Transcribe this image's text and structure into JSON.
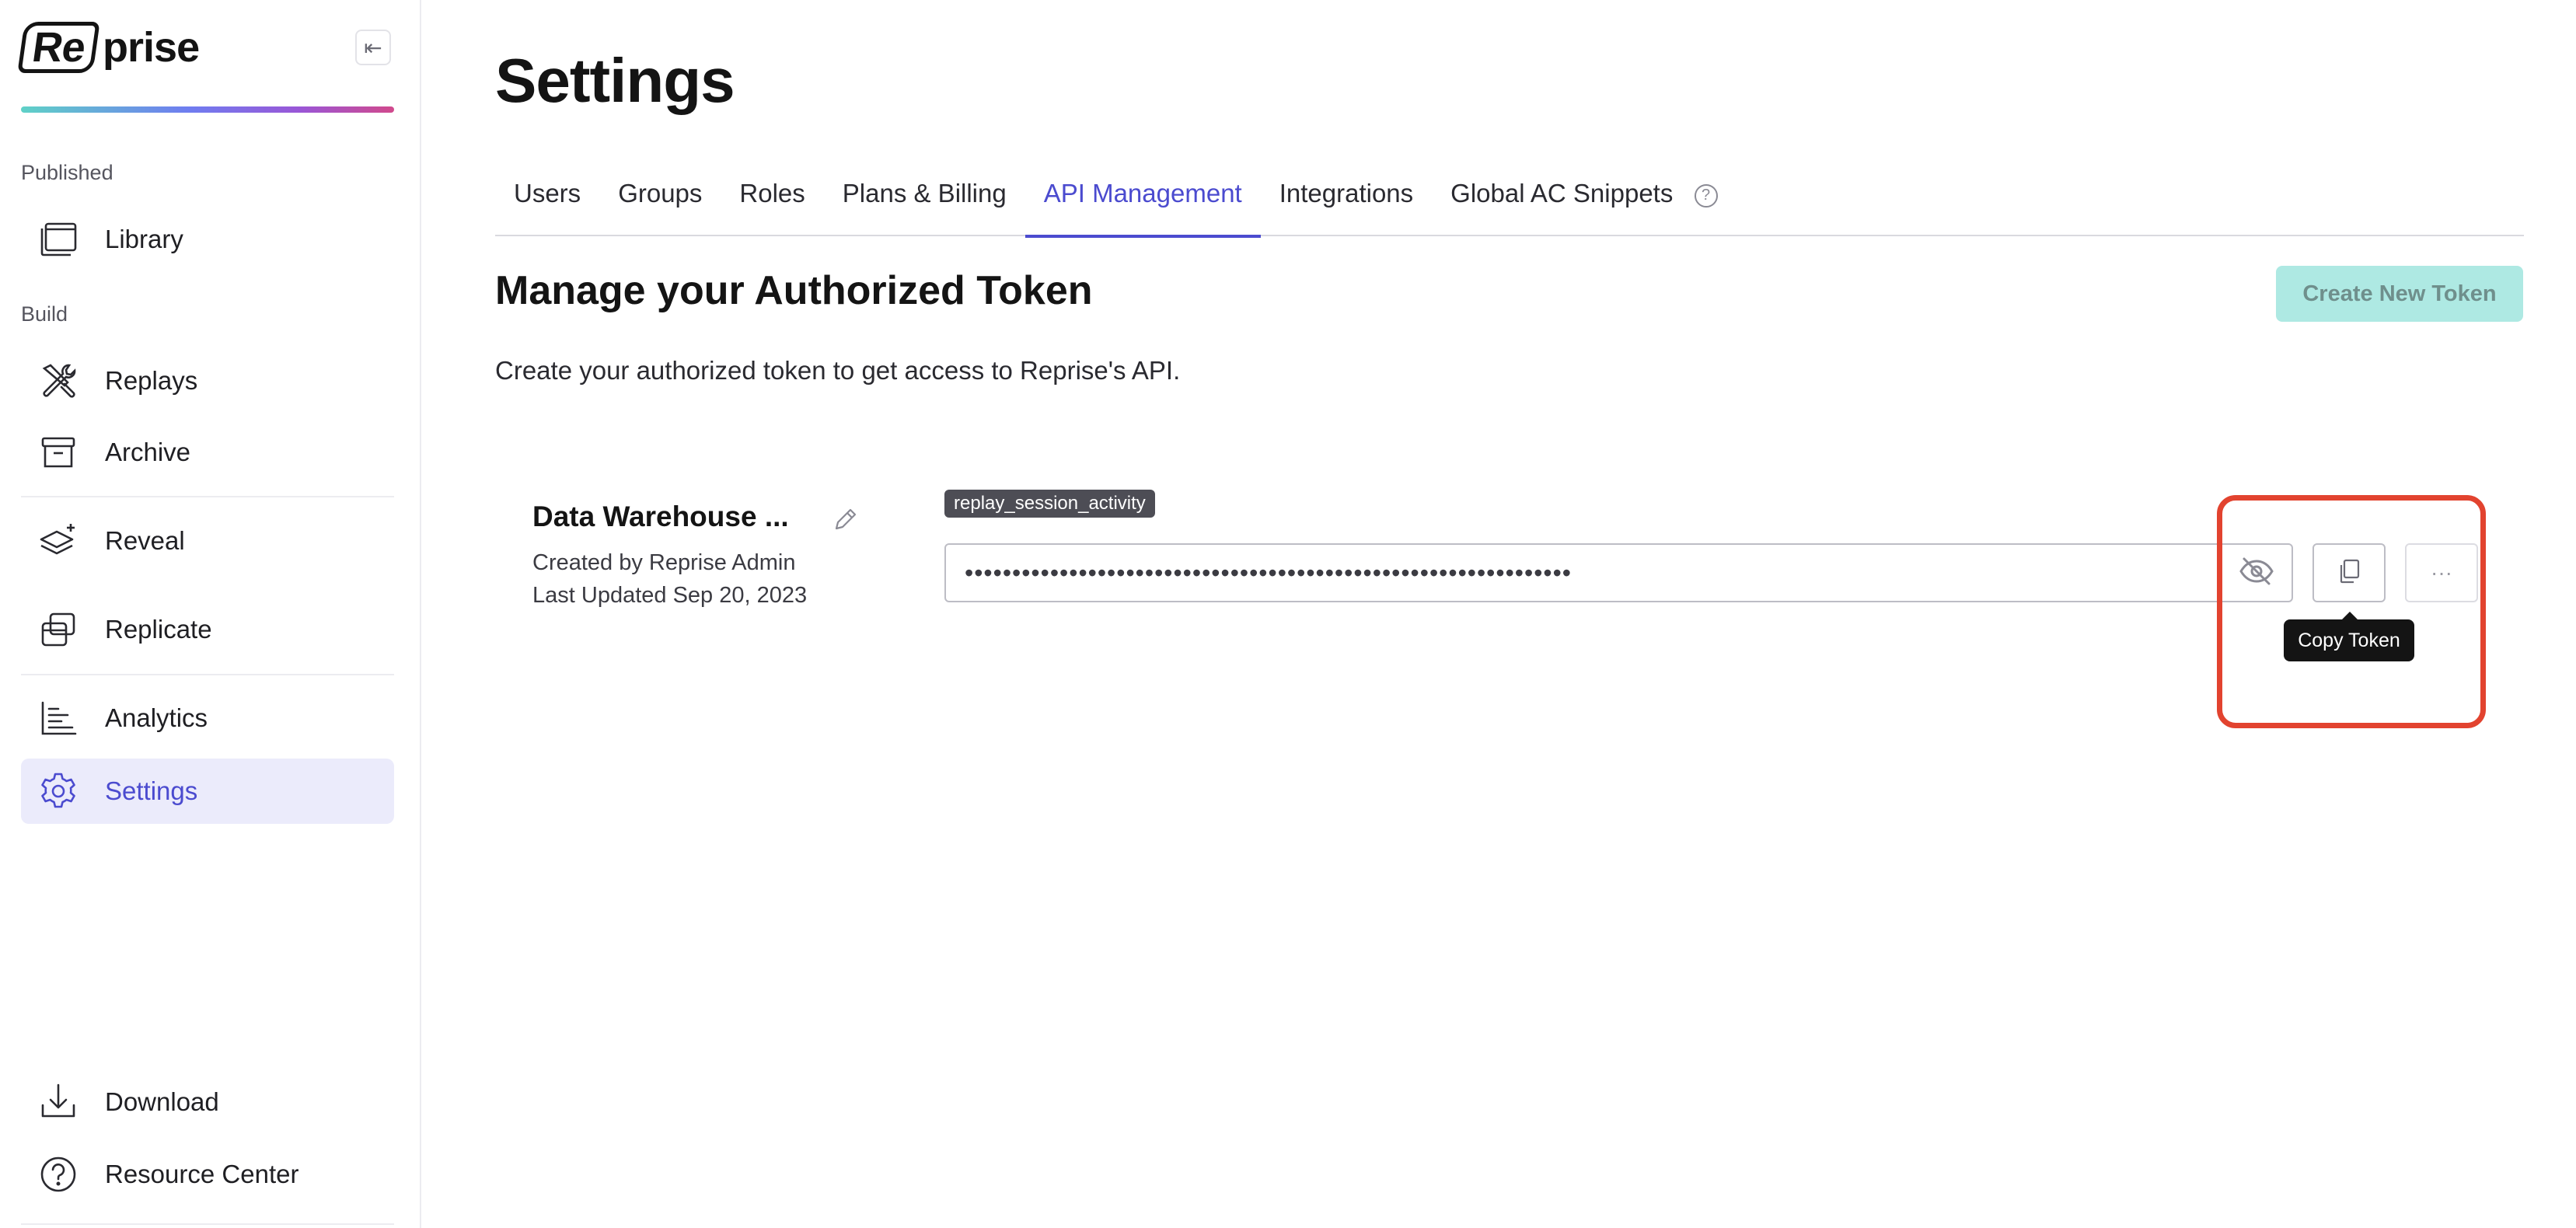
{
  "sidebar": {
    "logo_re": "Re",
    "logo_prise": "prise",
    "collapse_glyph": "⇤",
    "sections": {
      "published": "Published",
      "build": "Build"
    },
    "items": [
      {
        "label": "Library",
        "icon": "library-icon"
      },
      {
        "label": "Replays",
        "icon": "tools-icon"
      },
      {
        "label": "Archive",
        "icon": "archive-icon"
      },
      {
        "label": "Reveal",
        "icon": "layers-icon"
      },
      {
        "label": "Replicate",
        "icon": "replicate-icon"
      },
      {
        "label": "Analytics",
        "icon": "analytics-icon"
      },
      {
        "label": "Settings",
        "icon": "gear-icon",
        "active": true
      },
      {
        "label": "Download",
        "icon": "download-icon"
      },
      {
        "label": "Resource Center",
        "icon": "help-circle-icon"
      }
    ]
  },
  "main": {
    "title": "Settings",
    "tabs": [
      {
        "label": "Users"
      },
      {
        "label": "Groups"
      },
      {
        "label": "Roles"
      },
      {
        "label": "Plans & Billing"
      },
      {
        "label": "API Management",
        "active": true
      },
      {
        "label": "Integrations"
      },
      {
        "label": "Global AC Snippets"
      }
    ],
    "help_glyph": "?",
    "section_title": "Manage your Authorized Token",
    "create_button": "Create New Token",
    "subtitle": "Create your authorized token to get access to Reprise's API.",
    "token": {
      "name": "Data Warehouse ...",
      "created_by": "Created by Reprise Admin",
      "last_updated": "Last Updated Sep 20, 2023",
      "scope": "replay_session_activity",
      "masked_value": "••••••••••••••••••••••••••••••••••••••••••••••••••••••••••••••••",
      "more_glyph": "···",
      "tooltip": "Copy Token"
    }
  },
  "colors": {
    "accent": "#4b4bcf",
    "active_bg": "#ebebfb",
    "create_btn_bg": "#aee9e3",
    "highlight": "#e2432f"
  }
}
